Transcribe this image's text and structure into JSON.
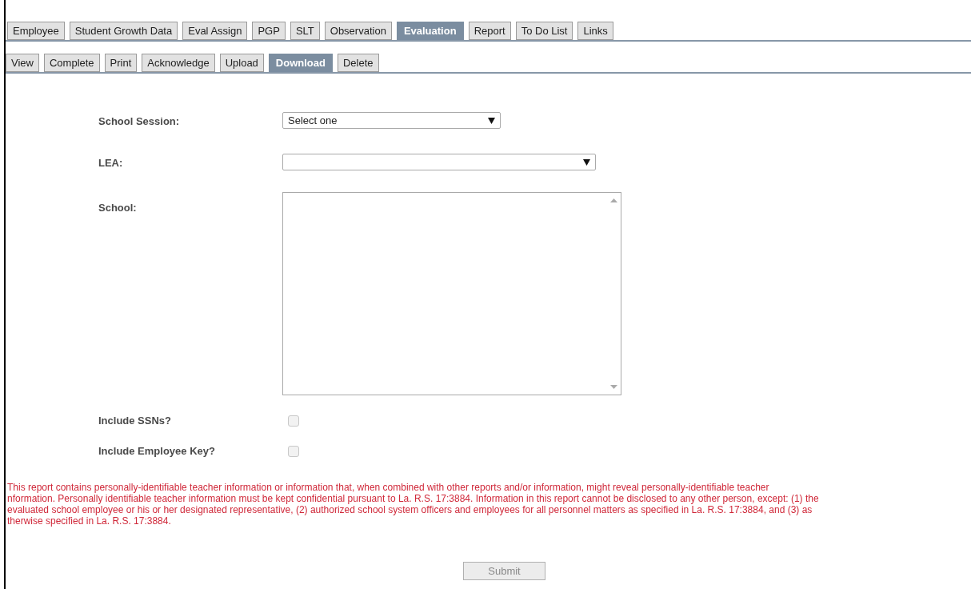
{
  "tabs": [
    {
      "label": "Employee",
      "selected": false
    },
    {
      "label": "Student Growth Data",
      "selected": false
    },
    {
      "label": "Eval Assign",
      "selected": false
    },
    {
      "label": "PGP",
      "selected": false
    },
    {
      "label": "SLT",
      "selected": false
    },
    {
      "label": "Observation",
      "selected": false
    },
    {
      "label": "Evaluation",
      "selected": true
    },
    {
      "label": "Report",
      "selected": false
    },
    {
      "label": "To Do List",
      "selected": false
    },
    {
      "label": "Links",
      "selected": false
    }
  ],
  "subtabs": [
    {
      "label": "View",
      "selected": false
    },
    {
      "label": "Complete",
      "selected": false
    },
    {
      "label": "Print",
      "selected": false
    },
    {
      "label": "Acknowledge",
      "selected": false
    },
    {
      "label": "Upload",
      "selected": false
    },
    {
      "label": "Download",
      "selected": true
    },
    {
      "label": "Delete",
      "selected": false
    }
  ],
  "form": [
    {
      "kind": "select",
      "label": "School Session:",
      "value": "Select one"
    },
    {
      "kind": "select",
      "label": "LEA:"
    },
    {
      "kind": "listbox",
      "label": "School:"
    },
    {
      "kind": "checkbox",
      "label": "Include SSNs?",
      "checked": false
    },
    {
      "kind": "checkbox",
      "label": "Include Employee Key?",
      "checked": false
    }
  ],
  "disclaimer": [
    "This report contains personally-identifiable teacher information or information that, when combined with other reports and/or information, might reveal personally-identifiable teacher",
    "nformation. Personally identifiable teacher information must be kept confidential pursuant to La. R.S. 17:3884. Information in this report cannot be disclosed to any other person, except: (1) the",
    "evaluated school employee or his or her designated representative, (2) authorized school system officers and employees for all personnel matters as specified in La. R.S. 17:3884, and (3) as",
    "therwise specified in La. R.S. 17:3884."
  ],
  "submit": {
    "label": "Submit",
    "disabled": true
  }
}
